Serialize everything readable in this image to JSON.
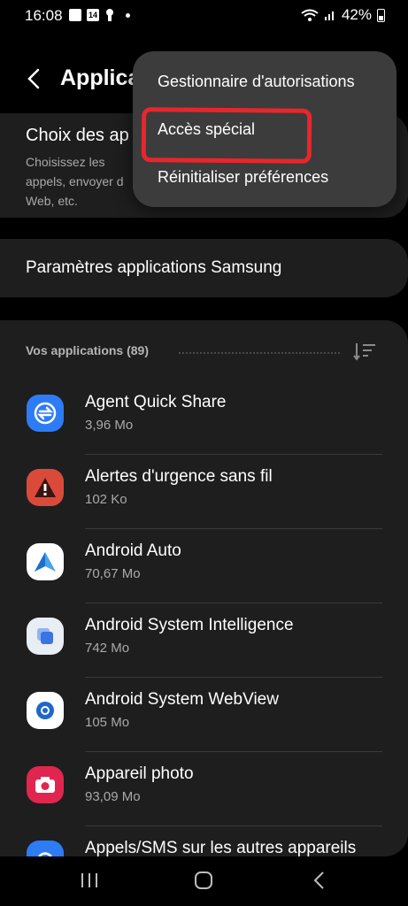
{
  "status": {
    "time": "16:08",
    "calendar_day": "14",
    "battery": "42%"
  },
  "header": {
    "title": "Applications"
  },
  "card1": {
    "title": "Choix des ap",
    "desc": "Choisissez les appels, envoyer d Web, etc."
  },
  "card2": {
    "label": "Paramètres applications Samsung"
  },
  "apps_section": {
    "header": "Vos applications (89)"
  },
  "apps": [
    {
      "name": "Agent Quick Share",
      "size": "3,96 Mo",
      "icon": "quick-share-icon",
      "color": "#2d7cf6"
    },
    {
      "name": "Alertes d'urgence sans fil",
      "size": "102 Ko",
      "icon": "emergency-alert-icon",
      "color": "#d94a3b"
    },
    {
      "name": "Android Auto",
      "size": "70,67 Mo",
      "icon": "android-auto-icon",
      "color": "#ffffff"
    },
    {
      "name": "Android System Intelligence",
      "size": "742 Mo",
      "icon": "system-intelligence-icon",
      "color": "#e9edf4"
    },
    {
      "name": "Android System WebView",
      "size": "105 Mo",
      "icon": "webview-icon",
      "color": "#ffffff"
    },
    {
      "name": "Appareil photo",
      "size": "93,09 Mo",
      "icon": "camera-icon",
      "color": "#e0264f"
    },
    {
      "name": "Appels/SMS sur les autres appareils",
      "size": "",
      "icon": "calls-sms-icon",
      "color": "#2d7cf6"
    }
  ],
  "menu": {
    "items": [
      "Gestionnaire d'autorisations",
      "Accès spécial",
      "Réinitialiser préférences"
    ],
    "highlight_color": "#e8262b"
  }
}
